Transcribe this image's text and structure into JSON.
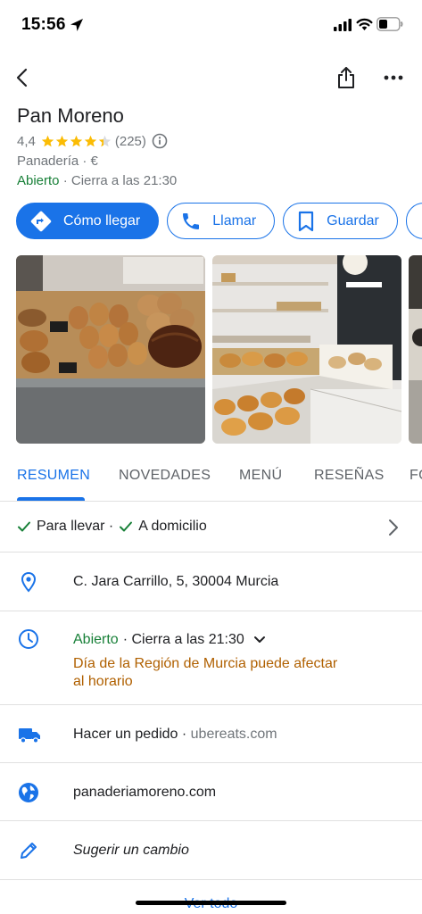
{
  "status_bar": {
    "time": "15:56"
  },
  "place": {
    "name": "Pan Moreno",
    "rating": "4,4",
    "stars": 4.4,
    "review_count": "(225)",
    "category": "Panadería · €",
    "status_open": "Abierto",
    "status_close": "· Cierra a las 21:30"
  },
  "actions": {
    "directions": "Cómo llegar",
    "call": "Llamar",
    "save": "Guardar"
  },
  "tabs": [
    "RESUMEN",
    "NOVEDADES",
    "MENÚ",
    "RESEÑAS",
    "FO"
  ],
  "services": {
    "takeaway": "Para llevar ·",
    "delivery": "A domicilio"
  },
  "address": "C. Jara Carrillo, 5, 30004 Murcia",
  "hours": {
    "open": "Abierto",
    "close": "· Cierra a las 21:30",
    "notice_line1": "Día de la Región de Murcia puede afectar",
    "notice_line2": "al horario"
  },
  "order": {
    "label": "Hacer un pedido ·",
    "site": "ubereats.com"
  },
  "website": "panaderiamoreno.com",
  "suggest_edit": "Sugerir un cambio",
  "see_all": "Ver todo",
  "colors": {
    "accent": "#1a73e8",
    "open_green": "#188038",
    "star": "#fbbc04",
    "warning": "#b06000"
  },
  "icons": [
    "location-arrow-icon",
    "signal-icon",
    "wifi-icon",
    "battery-icon",
    "back-icon",
    "share-icon",
    "more-icon",
    "star-icon",
    "info-icon",
    "directions-icon",
    "phone-icon",
    "bookmark-icon",
    "check-icon",
    "chevron-right-icon",
    "map-pin-icon",
    "clock-icon",
    "chevron-down-icon",
    "truck-icon",
    "globe-icon",
    "pencil-icon"
  ]
}
